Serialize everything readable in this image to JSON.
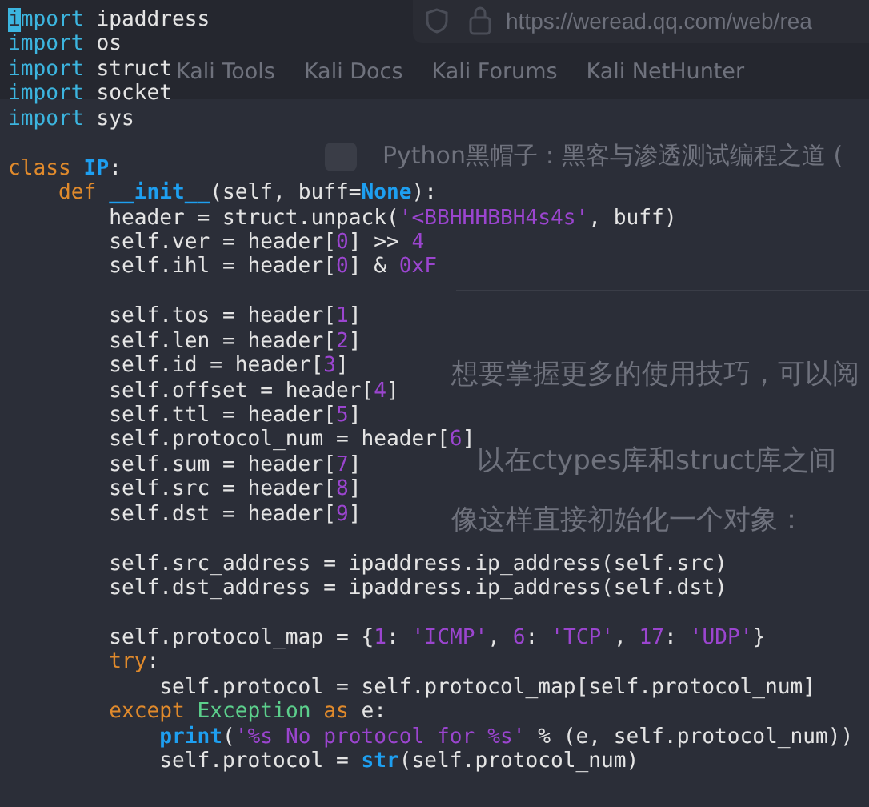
{
  "browser_behind": {
    "address": "https://weread.qq.com/web/rea",
    "bookmarks": [
      "Kali Tools",
      "Kali Docs",
      "Kali Forums",
      "Kali NetHunter"
    ],
    "book_title": "Python黑帽子：黑客与渗透测试编程之道 (",
    "paragraphs": [
      "想要掌握更多的使用技巧，可以阅",
      "以在ctypes库和struct库之间",
      "像这样直接初始化一个对象："
    ]
  },
  "editor": {
    "lines": [
      {
        "kind": "code",
        "tokens": [
          {
            "kind": "cursor",
            "text": "i"
          },
          {
            "kind": "import",
            "text": "mport"
          },
          {
            "kind": "plain",
            "text": " ipaddress"
          }
        ]
      },
      {
        "kind": "code",
        "tokens": [
          {
            "kind": "import",
            "text": "import"
          },
          {
            "kind": "plain",
            "text": " os"
          }
        ]
      },
      {
        "kind": "code",
        "tokens": [
          {
            "kind": "import",
            "text": "import"
          },
          {
            "kind": "plain",
            "text": " struct"
          }
        ]
      },
      {
        "kind": "code",
        "tokens": [
          {
            "kind": "import",
            "text": "import"
          },
          {
            "kind": "plain",
            "text": " socket"
          }
        ]
      },
      {
        "kind": "code",
        "tokens": [
          {
            "kind": "import",
            "text": "import"
          },
          {
            "kind": "plain",
            "text": " sys"
          }
        ]
      },
      {
        "kind": "blank"
      },
      {
        "kind": "code",
        "tokens": [
          {
            "kind": "keyword",
            "text": "class"
          },
          {
            "kind": "name",
            "text": " IP"
          },
          {
            "kind": "plain",
            "text": ":"
          }
        ]
      },
      {
        "kind": "code",
        "tokens": [
          {
            "kind": "keyword",
            "text": "    def"
          },
          {
            "kind": "name",
            "text": " __init__"
          },
          {
            "kind": "plain",
            "text": "(self, buff="
          },
          {
            "kind": "name",
            "text": "None"
          },
          {
            "kind": "plain",
            "text": "):"
          }
        ]
      },
      {
        "kind": "code",
        "tokens": [
          {
            "kind": "plain",
            "text": "        header = struct.unpack("
          },
          {
            "kind": "string",
            "text": "'<BBHHHBBH4s4s'"
          },
          {
            "kind": "plain",
            "text": ", buff)"
          }
        ]
      },
      {
        "kind": "code",
        "tokens": [
          {
            "kind": "plain",
            "text": "        self.ver = header["
          },
          {
            "kind": "number",
            "text": "0"
          },
          {
            "kind": "plain",
            "text": "] >> "
          },
          {
            "kind": "number",
            "text": "4"
          }
        ]
      },
      {
        "kind": "code",
        "tokens": [
          {
            "kind": "plain",
            "text": "        self.ihl = header["
          },
          {
            "kind": "number",
            "text": "0"
          },
          {
            "kind": "plain",
            "text": "] & "
          },
          {
            "kind": "number",
            "text": "0xF"
          }
        ]
      },
      {
        "kind": "blank"
      },
      {
        "kind": "code",
        "tokens": [
          {
            "kind": "plain",
            "text": "        self.tos = header["
          },
          {
            "kind": "number",
            "text": "1"
          },
          {
            "kind": "plain",
            "text": "]"
          }
        ]
      },
      {
        "kind": "code",
        "tokens": [
          {
            "kind": "plain",
            "text": "        self.len = header["
          },
          {
            "kind": "number",
            "text": "2"
          },
          {
            "kind": "plain",
            "text": "]"
          }
        ]
      },
      {
        "kind": "code",
        "tokens": [
          {
            "kind": "plain",
            "text": "        self.id = header["
          },
          {
            "kind": "number",
            "text": "3"
          },
          {
            "kind": "plain",
            "text": "]"
          }
        ]
      },
      {
        "kind": "code",
        "tokens": [
          {
            "kind": "plain",
            "text": "        self.offset = header["
          },
          {
            "kind": "number",
            "text": "4"
          },
          {
            "kind": "plain",
            "text": "]"
          }
        ]
      },
      {
        "kind": "code",
        "tokens": [
          {
            "kind": "plain",
            "text": "        self.ttl = header["
          },
          {
            "kind": "number",
            "text": "5"
          },
          {
            "kind": "plain",
            "text": "]"
          }
        ]
      },
      {
        "kind": "code",
        "tokens": [
          {
            "kind": "plain",
            "text": "        self.protocol_num = header["
          },
          {
            "kind": "number",
            "text": "6"
          },
          {
            "kind": "plain",
            "text": "]"
          }
        ]
      },
      {
        "kind": "code",
        "tokens": [
          {
            "kind": "plain",
            "text": "        self.sum = header["
          },
          {
            "kind": "number",
            "text": "7"
          },
          {
            "kind": "plain",
            "text": "]"
          }
        ]
      },
      {
        "kind": "code",
        "tokens": [
          {
            "kind": "plain",
            "text": "        self.src = header["
          },
          {
            "kind": "number",
            "text": "8"
          },
          {
            "kind": "plain",
            "text": "]"
          }
        ]
      },
      {
        "kind": "code",
        "tokens": [
          {
            "kind": "plain",
            "text": "        self.dst = header["
          },
          {
            "kind": "number",
            "text": "9"
          },
          {
            "kind": "plain",
            "text": "]"
          }
        ]
      },
      {
        "kind": "blank"
      },
      {
        "kind": "code",
        "tokens": [
          {
            "kind": "plain",
            "text": "        self.src_address = ipaddress.ip_address(self.src)"
          }
        ]
      },
      {
        "kind": "code",
        "tokens": [
          {
            "kind": "plain",
            "text": "        self.dst_address = ipaddress.ip_address(self.dst)"
          }
        ]
      },
      {
        "kind": "blank"
      },
      {
        "kind": "code",
        "tokens": [
          {
            "kind": "plain",
            "text": "        self.protocol_map = {"
          },
          {
            "kind": "number",
            "text": "1"
          },
          {
            "kind": "plain",
            "text": ": "
          },
          {
            "kind": "string",
            "text": "'ICMP'"
          },
          {
            "kind": "plain",
            "text": ", "
          },
          {
            "kind": "number",
            "text": "6"
          },
          {
            "kind": "plain",
            "text": ": "
          },
          {
            "kind": "string",
            "text": "'TCP'"
          },
          {
            "kind": "plain",
            "text": ", "
          },
          {
            "kind": "number",
            "text": "17"
          },
          {
            "kind": "plain",
            "text": ": "
          },
          {
            "kind": "string",
            "text": "'UDP'"
          },
          {
            "kind": "plain",
            "text": "}"
          }
        ]
      },
      {
        "kind": "code",
        "tokens": [
          {
            "kind": "keyword",
            "text": "        try"
          },
          {
            "kind": "plain",
            "text": ":"
          }
        ]
      },
      {
        "kind": "code",
        "tokens": [
          {
            "kind": "plain",
            "text": "            self.protocol = self.protocol_map[self.protocol_num]"
          }
        ]
      },
      {
        "kind": "code",
        "tokens": [
          {
            "kind": "keyword",
            "text": "        except"
          },
          {
            "kind": "class",
            "text": " Exception"
          },
          {
            "kind": "keyword",
            "text": " as"
          },
          {
            "kind": "plain",
            "text": " e:"
          }
        ]
      },
      {
        "kind": "code",
        "tokens": [
          {
            "kind": "name",
            "text": "            print"
          },
          {
            "kind": "plain",
            "text": "("
          },
          {
            "kind": "string",
            "text": "'%s No protocol for %s'"
          },
          {
            "kind": "plain",
            "text": " % (e, self.protocol_num))"
          }
        ]
      },
      {
        "kind": "code",
        "tokens": [
          {
            "kind": "plain",
            "text": "            self.protocol = "
          },
          {
            "kind": "name",
            "text": "str"
          },
          {
            "kind": "plain",
            "text": "(self.protocol_num)"
          }
        ]
      }
    ]
  }
}
